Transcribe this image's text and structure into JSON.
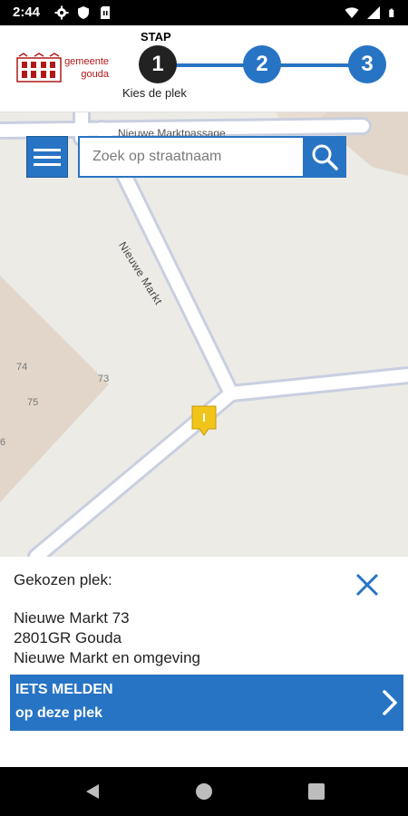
{
  "status_bar": {
    "time": "2:44",
    "left_icons": [
      "gear-icon",
      "shield-icon",
      "sim-card-icon"
    ],
    "right_icons": [
      "wifi-icon",
      "signal-icon",
      "battery-icon"
    ]
  },
  "header": {
    "logo": {
      "line1": "gemeente",
      "line2": "gouda"
    },
    "stap_label": "STAP",
    "steps": [
      "1",
      "2",
      "3"
    ],
    "active_step": 1,
    "step_caption": "Kies de plek",
    "colors": {
      "active": "#222222",
      "inactive": "#2874c4"
    }
  },
  "map": {
    "street_name_top": "Nieuwe Marktpassage",
    "street_name_diag": "Nieuwe Markt",
    "house_numbers": [
      "74",
      "73",
      "75",
      "6"
    ]
  },
  "search": {
    "placeholder": "Zoek op straatnaam"
  },
  "panel": {
    "title": "Gekozen plek:",
    "address_line1": "Nieuwe Markt 73",
    "address_line2": "2801GR Gouda",
    "address_line3": "Nieuwe Markt en omgeving",
    "report_line1": "IETS MELDEN",
    "report_line2": "op deze plek"
  },
  "icons": {
    "menu": "hamburger-menu-icon",
    "search": "search-icon",
    "close": "close-icon",
    "marker": "location-pin-icon",
    "chevron": "chevron-right-icon"
  },
  "brand_color": "#2874c4"
}
